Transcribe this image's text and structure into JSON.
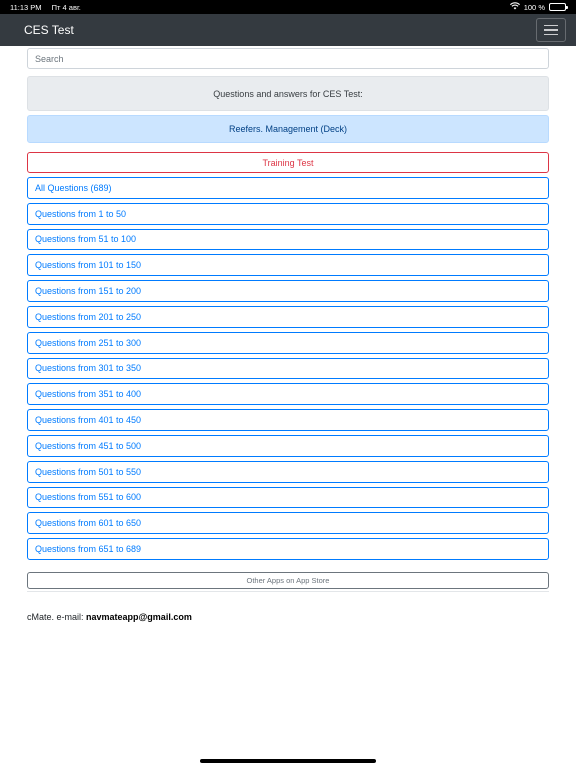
{
  "status": {
    "time": "11:13 PM",
    "date": "Пт 4 авг.",
    "battery": "100 %",
    "battery_level_percent": 100,
    "wifi_icon": "wifi-icon"
  },
  "navbar": {
    "title": "CES Test",
    "menu_icon": "hamburger-icon"
  },
  "search": {
    "placeholder": "Search",
    "value": ""
  },
  "header_text": "Questions and answers for CES Test:",
  "category": "Reefers. Management (Deck)",
  "training_test": "Training Test",
  "questions": [
    "All Questions (689)",
    "Questions from 1 to 50",
    "Questions from 51 to 100",
    "Questions from 101 to 150",
    "Questions from 151 to 200",
    "Questions from 201 to 250",
    "Questions from 251 to 300",
    "Questions from 301 to 350",
    "Questions from 351 to 400",
    "Questions from 401 to 450",
    "Questions from 451 to 500",
    "Questions from 501 to 550",
    "Questions from 551 to 600",
    "Questions from 601 to 650",
    "Questions from 651 to 689"
  ],
  "other_apps": "Other Apps on App Store",
  "footer": {
    "prefix": "cMate. e-mail: ",
    "email": "navmateapp@gmail.com"
  },
  "colors": {
    "navbar": "#343a40",
    "primary": "#007bff",
    "danger": "#dc3545",
    "secondary": "#6c757d",
    "info_bg": "#cce5ff"
  }
}
